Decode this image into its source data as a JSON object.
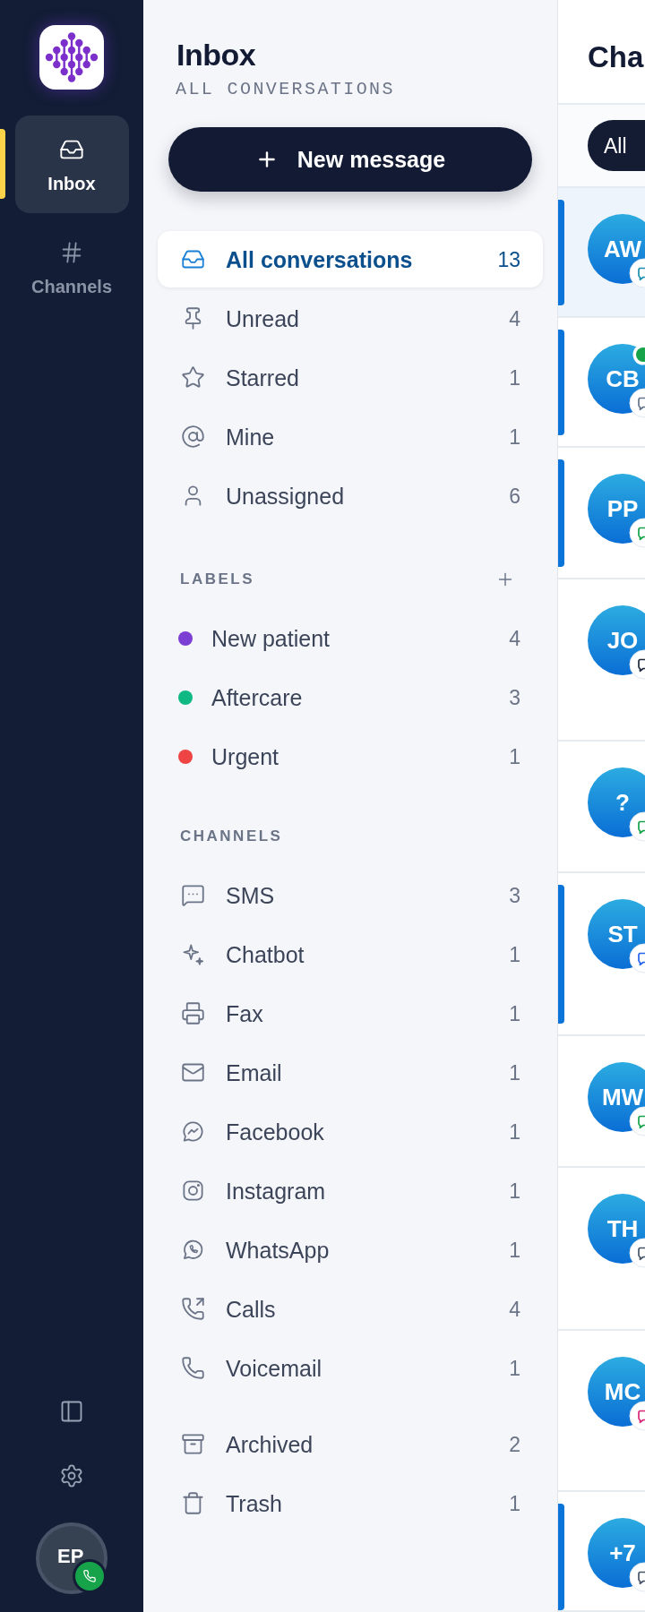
{
  "rail": {
    "items": [
      {
        "kind": "inbox",
        "label": "Inbox",
        "selected": true
      },
      {
        "kind": "channels",
        "label": "Channels",
        "selected": false
      }
    ],
    "user": {
      "initials": "EP"
    }
  },
  "inbox": {
    "title": "Inbox",
    "subtitle": "ALL CONVERSATIONS",
    "new_button": {
      "label": "New message"
    },
    "views": [
      {
        "kind": "all",
        "label": "All conversations",
        "count": "13",
        "selected": true
      },
      {
        "kind": "unread",
        "label": "Unread",
        "count": "4",
        "selected": false
      },
      {
        "kind": "starred",
        "label": "Starred",
        "count": "1",
        "selected": false
      },
      {
        "kind": "mine",
        "label": "Mine",
        "count": "1",
        "selected": false
      },
      {
        "kind": "unassigned",
        "label": "Unassigned",
        "count": "6",
        "selected": false
      }
    ],
    "labels": {
      "title": "LABELS",
      "items": [
        {
          "label": "New patient",
          "count": "4",
          "color": "#7b3fd4",
          "selected": false
        },
        {
          "label": "Aftercare",
          "count": "3",
          "color": "#10b981",
          "selected": false
        },
        {
          "label": "Urgent",
          "count": "1",
          "color": "#ef4444",
          "selected": false
        }
      ]
    },
    "channels": {
      "title": "CHANNELS",
      "items": [
        {
          "kind": "sms",
          "label": "SMS",
          "count": "3",
          "selected": false
        },
        {
          "kind": "chatbot",
          "label": "Chatbot",
          "count": "1",
          "selected": false
        },
        {
          "kind": "fax",
          "label": "Fax",
          "count": "1",
          "selected": false
        },
        {
          "kind": "email",
          "label": "Email",
          "count": "1",
          "selected": false
        },
        {
          "kind": "facebook",
          "label": "Facebook",
          "count": "1",
          "selected": false
        },
        {
          "kind": "instagram",
          "label": "Instagram",
          "count": "1",
          "selected": false
        },
        {
          "kind": "whatsapp",
          "label": "WhatsApp",
          "count": "1",
          "selected": false
        },
        {
          "kind": "calls",
          "label": "Calls",
          "count": "4",
          "selected": false
        },
        {
          "kind": "voicemail",
          "label": "Voicemail",
          "count": "1",
          "selected": false
        }
      ]
    },
    "folders": [
      {
        "kind": "archived",
        "label": "Archived",
        "count": "2",
        "selected": false
      },
      {
        "kind": "trash",
        "label": "Trash",
        "count": "1",
        "selected": false
      }
    ]
  },
  "chats": {
    "title": "Cha",
    "filters": [
      {
        "label": "All",
        "selected": true
      }
    ],
    "conversations": [
      {
        "initials": "AW",
        "selected": true,
        "unread": true,
        "online": false,
        "color": "#1d8fb0"
      },
      {
        "initials": "CB",
        "selected": false,
        "unread": true,
        "online": true,
        "color": "#64748b"
      },
      {
        "initials": "PP",
        "selected": false,
        "unread": true,
        "online": false,
        "color": "#16a34a"
      },
      {
        "initials": "JO",
        "selected": false,
        "unread": false,
        "online": false,
        "color": "#1e293b"
      },
      {
        "initials": "?",
        "selected": false,
        "unread": false,
        "online": false,
        "color": "#16a34a"
      },
      {
        "initials": "ST",
        "selected": false,
        "unread": true,
        "online": false,
        "color": "#2563eb"
      },
      {
        "initials": "MW",
        "selected": false,
        "unread": false,
        "online": false,
        "color": "#16a34a"
      },
      {
        "initials": "TH",
        "selected": false,
        "unread": false,
        "online": false,
        "color": "#475569"
      },
      {
        "initials": "MC",
        "selected": false,
        "unread": false,
        "online": false,
        "color": "#db2777"
      },
      {
        "initials": "+7",
        "selected": false,
        "unread": true,
        "online": false,
        "color": "#475569"
      }
    ]
  }
}
